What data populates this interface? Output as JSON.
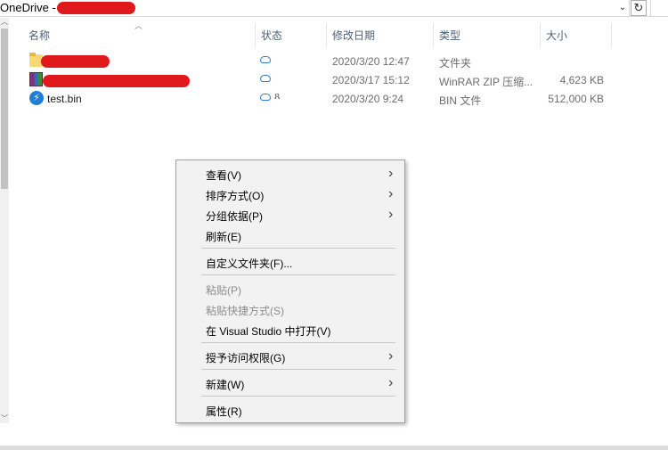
{
  "address": {
    "path_prefix": "OneDrive -",
    "dropdown_glyph": "⌄",
    "refresh_glyph": "↻"
  },
  "columns": {
    "name": "名称",
    "status": "状态",
    "modified": "修改日期",
    "type": "类型",
    "size": "大小"
  },
  "files": [
    {
      "name": "",
      "icon": "folder-icon",
      "status": "cloud",
      "modified": "2020/3/20 12:47",
      "type": "文件夹",
      "size": ""
    },
    {
      "name": "",
      "icon": "winrar-archive-icon",
      "status": "cloud",
      "modified": "2020/3/17 15:12",
      "type": "WinRAR ZIP 压缩...",
      "size": "4,623 KB"
    },
    {
      "name": "test.bin",
      "icon": "bin-file-icon",
      "status": "cloud-shared",
      "modified": "2020/3/20 9:24",
      "type": "BIN 文件",
      "size": "512,000 KB"
    }
  ],
  "context_menu": {
    "view": "查看(V)",
    "sort_by": "排序方式(O)",
    "group_by": "分组依据(P)",
    "refresh": "刷新(E)",
    "customize_folder": "自定义文件夹(F)...",
    "paste": "粘贴(P)",
    "paste_shortcut": "粘贴快捷方式(S)",
    "open_in_vs": "在 Visual Studio 中打开(V)",
    "give_access": "授予访问权限(G)",
    "new": "新建(W)",
    "properties": "属性(R)"
  },
  "colors": {
    "redaction": "#e0191c",
    "cloud_icon": "#2c7dd6",
    "menu_background": "#f2f2f2",
    "column_header_text": "#4c607a"
  }
}
